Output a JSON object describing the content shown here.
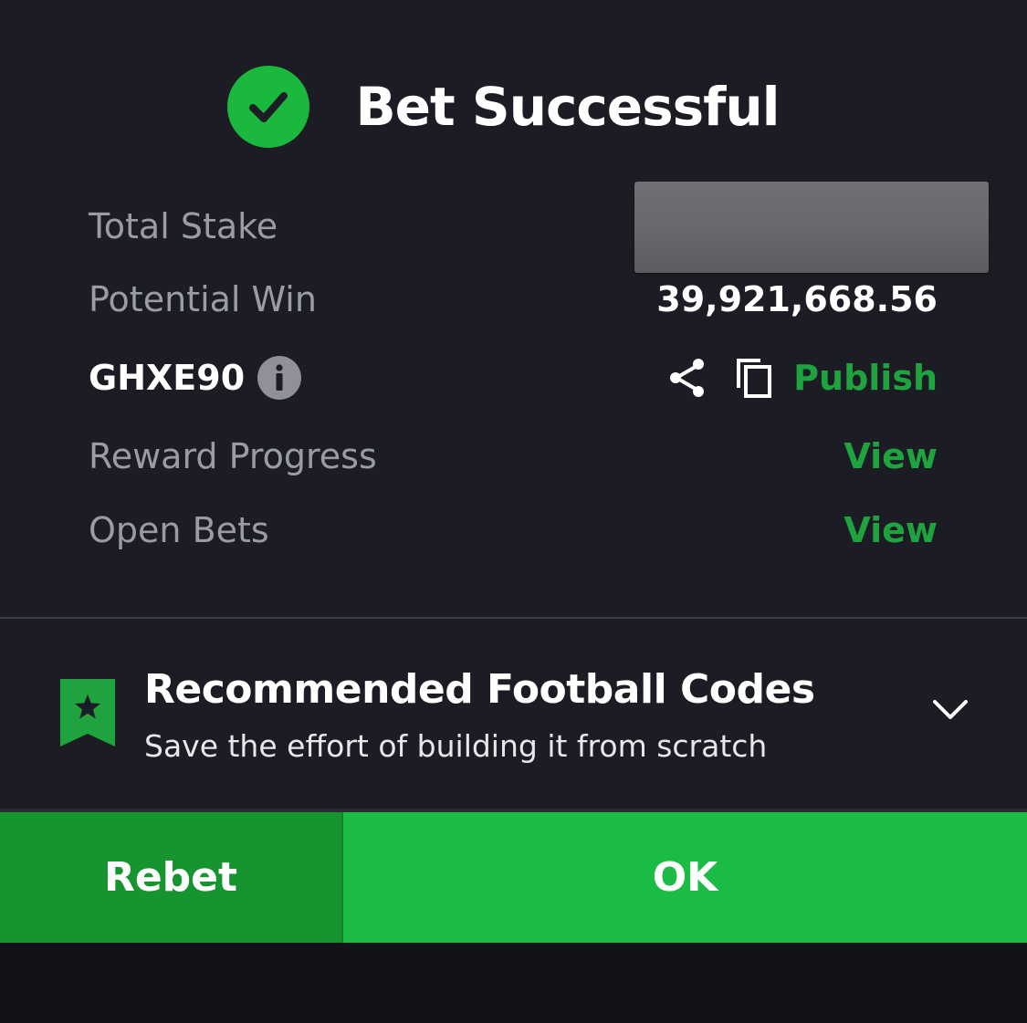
{
  "header": {
    "title": "Bet Successful",
    "icon": "check-circle-icon",
    "icon_color": "#1bb83e"
  },
  "summary": {
    "total_stake_label": "Total Stake",
    "total_stake_value": "",
    "potential_win_label": "Potential Win",
    "potential_win_value": "39,921,668.56",
    "booking_code": "GHXE90",
    "publish_label": "Publish",
    "reward_progress_label": "Reward Progress",
    "reward_progress_link": "View",
    "open_bets_label": "Open Bets",
    "open_bets_link": "View"
  },
  "recommendation": {
    "title": "Recommended Football Codes",
    "subtitle": "Save the effort of building it from scratch"
  },
  "actions": {
    "rebet_label": "Rebet",
    "ok_label": "OK"
  },
  "colors": {
    "accent_green": "#1fa33f",
    "ok_button": "#1bbc45",
    "rebet_button": "#16942f",
    "background": "#1c1d24"
  }
}
